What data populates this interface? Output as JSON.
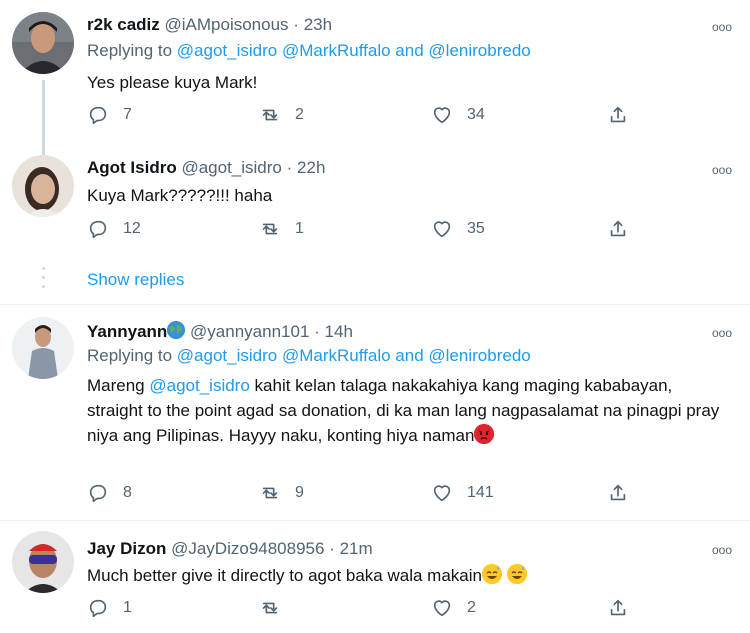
{
  "tweets": [
    {
      "name": "r2k cadiz",
      "handle": "@iAMpoisonous",
      "sep": "·",
      "time": "23h",
      "replying_prefix": "Replying to",
      "replying_1": "@agot_isidro",
      "replying_2": "@MarkRuffalo",
      "replying_and": "and",
      "replying_3": "@lenirobredo",
      "text": "Yes please kuya Mark!",
      "replies": "7",
      "retweets": "2",
      "likes": "34"
    },
    {
      "name": "Agot Isidro",
      "handle": "@agot_isidro",
      "sep": "·",
      "time": "22h",
      "text": "Kuya Mark?????!!! haha",
      "replies": "12",
      "retweets": "1",
      "likes": "35",
      "show_replies": "Show replies"
    },
    {
      "name": "Yannyann",
      "handle": "@yannyann101",
      "sep": "·",
      "time": "14h",
      "replying_prefix": "Replying to",
      "replying_1": "@agot_isidro",
      "replying_2": "@MarkRuffalo",
      "replying_and": "and",
      "replying_3": "@lenirobredo",
      "text_1": "Mareng",
      "text_mention": "@agot_isidro",
      "text_2": "kahit kelan talaga nakakahiya kang maging kababayan, straight to the point agad sa donation, di ka man lang nagpasalamat na pinagpi pray niya ang Pilipinas. Hayyy naku, konting hiya naman",
      "replies": "8",
      "retweets": "9",
      "likes": "141"
    },
    {
      "name": "Jay Dizon",
      "handle": "@JayDizo94808956",
      "sep": "·",
      "time": "21m",
      "text": "Much better give it directly to agot baka wala makain",
      "replies": "1",
      "retweets": "",
      "likes": "2"
    }
  ],
  "icons": {
    "reply": "reply-icon",
    "retweet": "retweet-icon",
    "like": "heart-icon",
    "share": "share-icon",
    "more": "more-icon"
  },
  "colors": {
    "link": "#1d9bf0",
    "secondary_text": "#536471",
    "primary_text": "#0f1419"
  }
}
